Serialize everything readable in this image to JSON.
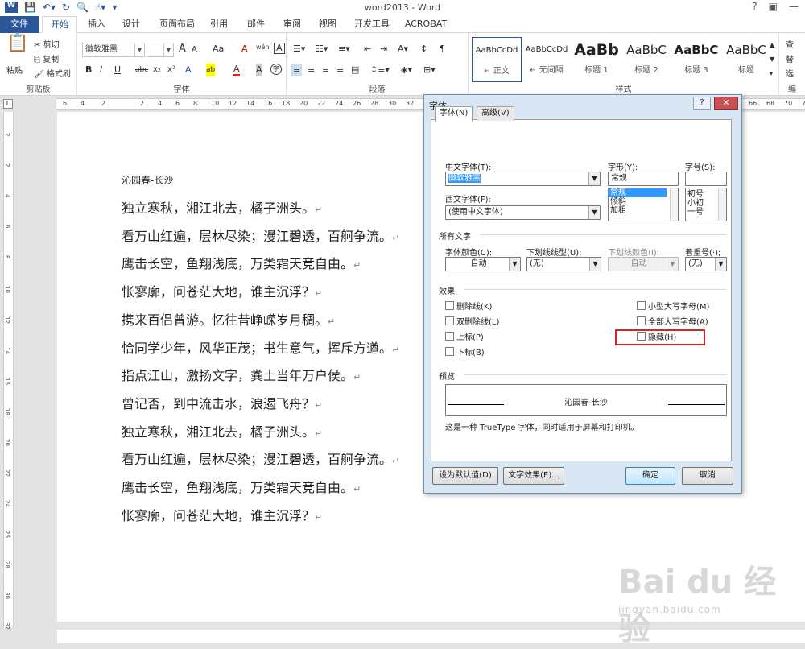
{
  "window": {
    "title": "word2013 - Word",
    "help": "?"
  },
  "tabs": [
    "文件",
    "开始",
    "插入",
    "设计",
    "页面布局",
    "引用",
    "邮件",
    "审阅",
    "视图",
    "开发工具",
    "ACROBAT"
  ],
  "ribbon": {
    "clipboard": {
      "paste": "粘贴",
      "cut": "剪切",
      "copy": "复制",
      "format_painter": "格式刷",
      "label": "剪贴板"
    },
    "font": {
      "name": "微软雅黑",
      "size": "",
      "label": "字体",
      "bold": "B",
      "italic": "I",
      "underline": "U",
      "strike": "abc",
      "sub": "x₂",
      "sup": "x²",
      "grow": "A",
      "shrink": "A",
      "case": "Aa",
      "clear": "A",
      "phonetic": "wén",
      "charborder": "A",
      "effects": "A",
      "highlight": "ab",
      "color": "A",
      "shade": "A",
      "enclose": "字"
    },
    "paragraph": {
      "label": "段落"
    },
    "styles": {
      "label": "样式",
      "items": [
        {
          "sample": "AaBbCcDd",
          "name": "↵ 正文"
        },
        {
          "sample": "AaBbCcDd",
          "name": "↵ 无间隔"
        },
        {
          "sample": "AaBb",
          "name": "标题 1"
        },
        {
          "sample": "AaBbC",
          "name": "标题 2"
        },
        {
          "sample": "AaBbC",
          "name": "标题 3"
        },
        {
          "sample": "AaBbC",
          "name": "标题"
        }
      ]
    },
    "editing": {
      "find": "查",
      "replace": "替",
      "select": "选",
      "label": "编"
    }
  },
  "ruler": {
    "h": [
      "6",
      "4",
      "2",
      "",
      "2",
      "4",
      "6",
      "8",
      "10",
      "12",
      "14",
      "16",
      "18",
      "20",
      "22",
      "24",
      "26",
      "28",
      "30",
      "32",
      "66",
      "68",
      "70",
      "7"
    ],
    "v": [
      "2",
      "2",
      "4",
      "6",
      "8",
      "10",
      "12",
      "14",
      "16",
      "18",
      "20",
      "22",
      "24",
      "26",
      "28",
      "30",
      "32"
    ]
  },
  "document": {
    "title": "沁园春-长沙",
    "lines": [
      "独立寒秋，湘江北去，橘子洲头。",
      "看万山红遍，层林尽染；漫江碧透，百舸争流。",
      "鹰击长空，鱼翔浅底，万类霜天竞自由。",
      "怅寥廓，问苍茫大地，谁主沉浮？",
      "携来百侣曾游。忆往昔峥嵘岁月稠。",
      "恰同学少年，风华正茂；书生意气，挥斥方遒。",
      "指点江山，激扬文字，粪土当年万户侯。",
      "曾记否，到中流击水，浪遏飞舟？",
      "独立寒秋，湘江北去，橘子洲头。",
      "看万山红遍，层林尽染；漫江碧透，百舸争流。",
      "鹰击长空，鱼翔浅底，万类霜天竞自由。",
      "怅寥廓，问苍茫大地，谁主沉浮？"
    ],
    "para_mark": "↵"
  },
  "dialog": {
    "title": "字体",
    "tabs": [
      "字体(N)",
      "高级(V)"
    ],
    "cn_font_label": "中文字体(T):",
    "cn_font_value": "微软雅黑",
    "west_font_label": "西文字体(F):",
    "west_font_value": "(使用中文字体)",
    "style_label": "字形(Y):",
    "style_value": "常规",
    "style_options": [
      "常规",
      "倾斜",
      "加粗"
    ],
    "size_label": "字号(S):",
    "size_value": "",
    "size_options": [
      "初号",
      "小初",
      "一号"
    ],
    "all_text_label": "所有文字",
    "font_color_label": "字体颜色(C):",
    "font_color_value": "自动",
    "underline_label": "下划线线型(U):",
    "underline_value": "(无)",
    "underline_color_label": "下划线颜色(I):",
    "underline_color_value": "自动",
    "emphasis_label": "着重号(·);",
    "emphasis_value": "(无)",
    "effects_label": "效果",
    "effects": [
      "删除线(K)",
      "双删除线(L)",
      "上标(P)",
      "下标(B)"
    ],
    "effects_right": [
      "小型大写字母(M)",
      "全部大写字母(A)",
      "隐藏(H)"
    ],
    "preview_label": "预览",
    "preview_text": "沁园春-长沙",
    "truetype_note": "这是一种 TrueType 字体，同时适用于屏幕和打印机。",
    "btn_default": "设为默认值(D)",
    "btn_effects": "文字效果(E)...",
    "btn_ok": "确定",
    "btn_cancel": "取消"
  },
  "watermark": {
    "brand": "Bai du 经验",
    "url": "jingyan.baidu.com"
  },
  "colors": {
    "accent": "#2b579a",
    "highlight": "#e02020"
  }
}
